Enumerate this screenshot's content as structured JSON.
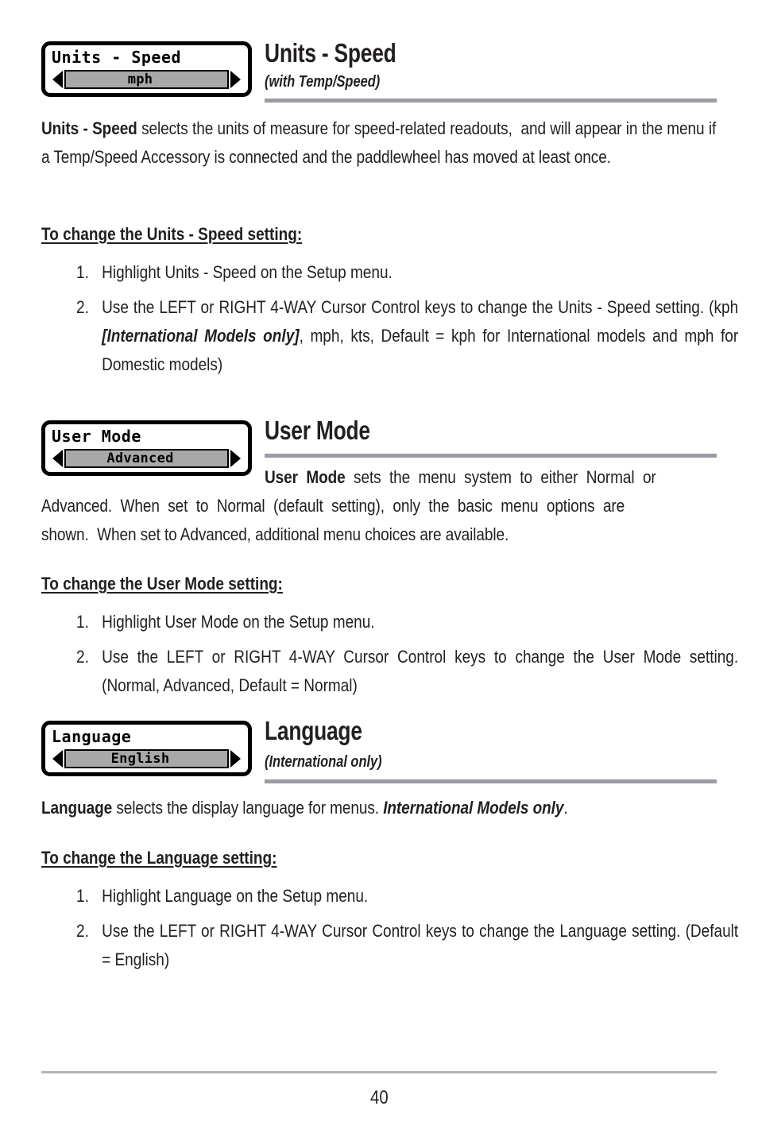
{
  "page": {
    "number": "40",
    "background": "#ffffff",
    "text_color": "#231f20",
    "rule_color": "#9b9ba3"
  },
  "sections": [
    {
      "id": "units-speed",
      "menu_box": {
        "label": "Units - Speed",
        "value": "mph",
        "left_arrow": "left-triangle-icon",
        "right_arrow": "right-triangle-icon"
      },
      "heading": "Units - Speed",
      "subtitle": "(with Temp/Speed)",
      "body_html": "<b>Units - Speed</b> selects the units of measure for speed-related readouts,&nbsp; and will appear in the menu if a Temp/Speed Accessory is connected and the paddlewheel has moved at least once.",
      "subhead": "To change the Units - Speed setting:",
      "steps": [
        {
          "num": "1.",
          "html": "Highlight Units - Speed on the Setup menu."
        },
        {
          "num": "2.",
          "html": "Use the LEFT or RIGHT 4-WAY Cursor Control keys to change the Units - Speed setting. (kph <span class=\"bi\">[International Models only]</span>, mph, kts, Default = kph for International models and mph for Domestic models)"
        }
      ]
    },
    {
      "id": "user-mode",
      "menu_box": {
        "label": "User Mode",
        "value": "Advanced",
        "left_arrow": "left-triangle-icon",
        "right_arrow": "right-triangle-icon"
      },
      "heading": "User Mode",
      "subtitle": "",
      "body_html": "<b>User Mode</b> sets the menu system to either Normal or Advanced. When set to Normal (default setting), only the basic menu options are shown.&nbsp; When set to Advanced, additional menu choices are available.",
      "subhead": "To change the User Mode setting:",
      "steps": [
        {
          "num": "1.",
          "html": "Highlight User Mode on the Setup menu."
        },
        {
          "num": "2.",
          "html": "Use the LEFT or RIGHT 4-WAY Cursor Control keys to change the User Mode setting. (Normal, Advanced, Default = Normal)"
        }
      ]
    },
    {
      "id": "language",
      "menu_box": {
        "label": "Language",
        "value": "English",
        "left_arrow": "left-triangle-icon",
        "right_arrow": "right-triangle-icon"
      },
      "heading": "Language",
      "subtitle": "(International only)",
      "body_html": "<b>Language</b> selects the display language for menus. <span class=\"bi\">International Models only</span>.",
      "subhead": "To change the Language setting:",
      "steps": [
        {
          "num": "1.",
          "html": "Highlight Language on the Setup menu."
        },
        {
          "num": "2.",
          "html": "Use the LEFT or RIGHT 4-WAY Cursor Control keys to change the Language setting. (Default = English)"
        }
      ]
    }
  ]
}
